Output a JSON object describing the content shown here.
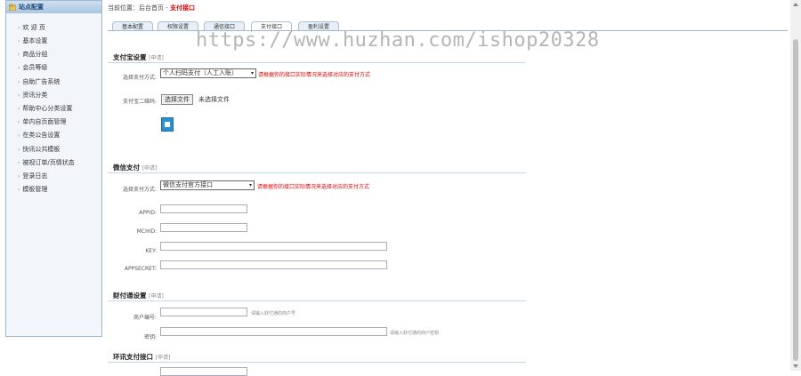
{
  "sidebar": {
    "header": "站点配置",
    "items": [
      {
        "label": "欢 迎 页"
      },
      {
        "label": "基本设置"
      },
      {
        "label": "商品分组"
      },
      {
        "label": "会员等级"
      },
      {
        "label": "自助广告系统"
      },
      {
        "label": "资讯分类"
      },
      {
        "label": "帮助中心分类设置"
      },
      {
        "label": "单内自页面管理"
      },
      {
        "label": "在类公告设置"
      },
      {
        "label": "快讯公共模板"
      },
      {
        "label": "被视订单/页情状态"
      },
      {
        "label": "登录日志"
      },
      {
        "label": "模板管理"
      }
    ]
  },
  "breadcrumb": {
    "prefix": "当前位置：后台首页 - ",
    "current": "支付接口"
  },
  "tabs": [
    {
      "label": "基本配置"
    },
    {
      "label": "权限设置"
    },
    {
      "label": "通信接口"
    },
    {
      "label": "支付接口"
    },
    {
      "label": "盈利设置"
    }
  ],
  "watermark": "https://www.huzhan.com/ishop20328",
  "alipay": {
    "title": "支付宝设置",
    "sub": "[申请]",
    "method_label": "选择支付方式:",
    "method_value": "个人扫码支付（人工入账）",
    "method_hint": "请根据你的接口实际情况来选择对应的支付方式",
    "qr_label": "支付宝二维码:",
    "file_button": "选择文件",
    "file_status": "未选择文件",
    "qr_mark": "ᵒ"
  },
  "wechat": {
    "title": "微信支付",
    "sub": "[申请]",
    "method_label": "选择支付方式:",
    "method_value": "微信支付官方接口",
    "method_hint": "请根据你的接口实际情况来选择对应的支付方式",
    "appid_label": "APPID:",
    "mchid_label": "MCHID:",
    "key_label": "KEY:",
    "appsecret_label": "APPSECRET:"
  },
  "tenpay": {
    "title": "财付通设置",
    "sub": "[申请]",
    "merchant_label": "商户编号:",
    "merchant_hint": "请输入财付通的商户号",
    "key_label": "密钥:",
    "key_hint": "请输入财付通的商户密钥"
  },
  "huanxun": {
    "title": "环讯支付接口",
    "sub": "[申请]"
  }
}
